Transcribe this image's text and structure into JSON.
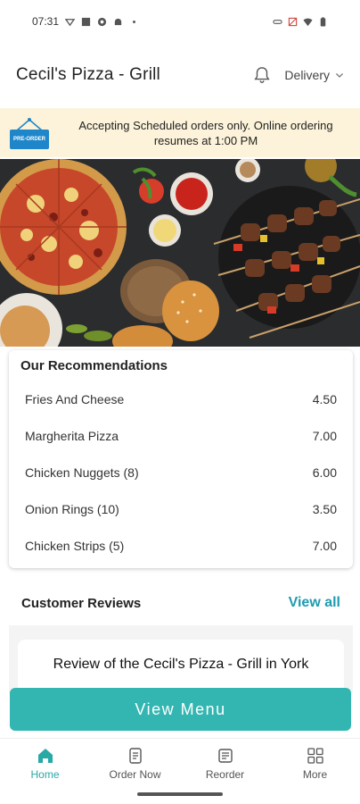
{
  "status": {
    "time": "07:31"
  },
  "header": {
    "title": "Cecil's Pizza - Grill",
    "mode": "Delivery"
  },
  "banner": {
    "badge": "PRE-ORDER",
    "message": "Accepting Scheduled orders only. Online ordering resumes at 1:00 PM"
  },
  "recommendations": {
    "title": "Our Recommendations",
    "items": [
      {
        "name": "Fries And Cheese",
        "price": "4.50"
      },
      {
        "name": "Margherita Pizza",
        "price": "7.00"
      },
      {
        "name": "Chicken Nuggets (8)",
        "price": "6.00"
      },
      {
        "name": "Onion Rings (10)",
        "price": "3.50"
      },
      {
        "name": "Chicken Strips (5)",
        "price": "7.00"
      }
    ]
  },
  "reviews": {
    "title": "Customer Reviews",
    "view_all": "View all",
    "card_title": "Review of the Cecil's Pizza - Grill in York"
  },
  "cta": {
    "label": "View Menu"
  },
  "nav": {
    "items": [
      {
        "label": "Home",
        "icon": "home-icon"
      },
      {
        "label": "Order Now",
        "icon": "order-icon"
      },
      {
        "label": "Reorder",
        "icon": "reorder-icon"
      },
      {
        "label": "More",
        "icon": "grid-icon"
      }
    ]
  },
  "colors": {
    "accent": "#33b6b1",
    "link": "#1f9bb0",
    "banner_bg": "#fcf3da"
  }
}
